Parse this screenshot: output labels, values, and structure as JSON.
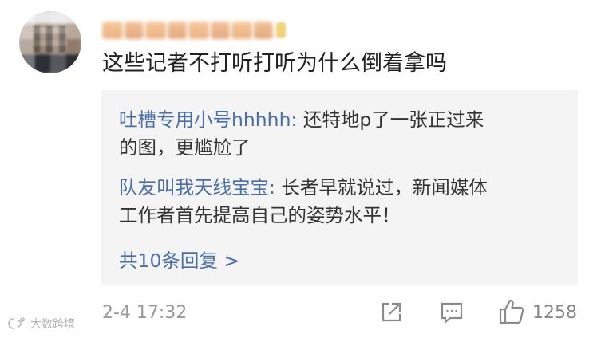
{
  "comment": {
    "text": "这些记者不打听打听为什么倒着拿吗",
    "time": "2-4 17:32",
    "like_count": "1258"
  },
  "replies": [
    {
      "name": "吐槽专用小号hhhhh",
      "sep": ": ",
      "text_line1": "还特地p了一张正过来",
      "text_line2": "的图，更尴尬了"
    },
    {
      "name": "队友叫我天线宝宝",
      "sep": ": ",
      "text_line1": "长者早就说过，新闻媒体",
      "text_line2": "工作者首先提高自己的姿势水平！"
    }
  ],
  "more_replies": "共10条回复 >",
  "watermark": "大数跨境",
  "icons": {
    "share": "share-icon",
    "comment": "comment-icon",
    "like": "thumbs-up-icon"
  },
  "colors": {
    "link": "#4a6ea8",
    "reply_bg": "#f4f4f4",
    "meta": "#999999"
  }
}
